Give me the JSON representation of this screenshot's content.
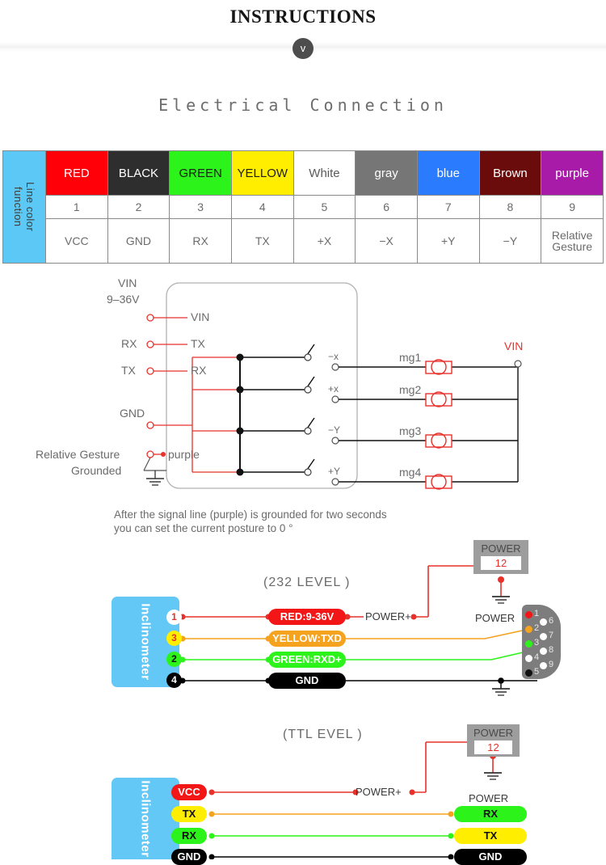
{
  "header": {
    "title": "INSTRUCTIONS",
    "chevron_icon": "chevron-down-icon",
    "chevron_glyph": "v",
    "section_title": "Electrical Connection"
  },
  "colors": {
    "accent_blue": "#63c8f5",
    "red": "#ff0008",
    "black": "#2e2e2e",
    "green": "#2cf319",
    "yellow": "#ffee00",
    "white": "#ffffff",
    "gray": "#767676",
    "blue": "#2b7bff",
    "brown": "#6b0c0c",
    "purple": "#a81aa8",
    "wire_red": "#e8312a",
    "wire_orange": "#f5a21e",
    "wire_green": "#2cf319",
    "power_gray": "#9d9d9d"
  },
  "table": {
    "row_header_label": "Line color\nfunction",
    "columns": [
      {
        "color_name": "RED",
        "bg": "#ff0008",
        "fg": "#ffffff",
        "number": "1",
        "function": "VCC"
      },
      {
        "color_name": "BLACK",
        "bg": "#2e2e2e",
        "fg": "#ffffff",
        "number": "2",
        "function": "GND"
      },
      {
        "color_name": "GREEN",
        "bg": "#2cf319",
        "fg": "#1d1d1d",
        "number": "3",
        "function": "RX"
      },
      {
        "color_name": "YELLOW",
        "bg": "#ffee00",
        "fg": "#1d1d1d",
        "number": "4",
        "function": "TX"
      },
      {
        "color_name": "White",
        "bg": "#ffffff",
        "fg": "#5a5a5a",
        "number": "5",
        "function": "+X"
      },
      {
        "color_name": "gray",
        "bg": "#767676",
        "fg": "#ffffff",
        "number": "6",
        "function": "−X"
      },
      {
        "color_name": "blue",
        "bg": "#2b7bff",
        "fg": "#ffffff",
        "number": "7",
        "function": "+Y"
      },
      {
        "color_name": "Brown",
        "bg": "#6b0c0c",
        "fg": "#ffffff",
        "number": "8",
        "function": "−Y"
      },
      {
        "color_name": "purple",
        "bg": "#a81aa8",
        "fg": "#ffffff",
        "number": "9",
        "function": "Relative\nGesture"
      }
    ]
  },
  "schematic": {
    "vin_label": "VIN",
    "vin_range": "9–36V",
    "left_terminals": [
      "RX",
      "TX"
    ],
    "inner_terminals": [
      "VIN",
      "TX",
      "RX"
    ],
    "gnd_label": "GND",
    "relative_gesture_label": "Relative Gesture",
    "grounded_label": "Grounded",
    "purple_label": "purple",
    "axis_terminals": [
      "−x",
      "+x",
      "−Y",
      "+Y"
    ],
    "coils": [
      "mg1",
      "mg2",
      "mg3",
      "mg4"
    ],
    "vin_right_label": "VIN",
    "caption_line1": "After the signal line (purple) is grounded for two seconds",
    "caption_line2": "you can set the current posture to 0 °"
  },
  "rs232": {
    "title": "(232 LEVEL )",
    "device_label": "Inclinometer",
    "rows": [
      {
        "pin": "1",
        "pin_bg": "#ffffff",
        "pin_fg": "#e8312a",
        "tag": "RED:9-36V",
        "tag_bg": "#f21616",
        "tag_fg": "#ffffff",
        "wire": "#e8312a"
      },
      {
        "pin": "3",
        "pin_bg": "#ffee00",
        "pin_fg": "#e8312a",
        "tag": "YELLOW:TXD",
        "tag_bg": "#f5a21e",
        "tag_fg": "#ffffff",
        "wire": "#f5a21e"
      },
      {
        "pin": "2",
        "pin_bg": "#2cf319",
        "pin_fg": "#111111",
        "tag": "GREEN:RXD+",
        "tag_bg": "#2cf319",
        "tag_fg": "#ffffff",
        "wire": "#2cf319"
      },
      {
        "pin": "4",
        "pin_bg": "#000000",
        "pin_fg": "#ffffff",
        "tag": "GND",
        "tag_bg": "#000000",
        "tag_fg": "#ffffff",
        "wire": "#000000"
      }
    ],
    "power_plus_label": "POWER+",
    "power_label": "POWER",
    "power_box": {
      "label": "POWER",
      "value": "12"
    },
    "db9_label": "POWER",
    "db9_pins_left": [
      {
        "n": "1",
        "color": "#f21616"
      },
      {
        "n": "2",
        "color": "#f5a21e"
      },
      {
        "n": "3",
        "color": "#2cf319"
      },
      {
        "n": "4",
        "color": "#ffffff"
      },
      {
        "n": "5",
        "color": "#111111"
      }
    ],
    "db9_pins_right": [
      {
        "n": "6",
        "color": "#ffffff"
      },
      {
        "n": "7",
        "color": "#ffffff"
      },
      {
        "n": "8",
        "color": "#ffffff"
      },
      {
        "n": "9",
        "color": "#ffffff"
      }
    ]
  },
  "ttl": {
    "title": "(TTL  EVEL )",
    "device_label": "Inclinometer",
    "power_plus_label": "POWER+",
    "power_label": "POWER",
    "power_box": {
      "label": "POWER",
      "value": "12"
    },
    "rows": [
      {
        "left_tag": "VCC",
        "left_bg": "#f21616",
        "left_fg": "#ffffff",
        "right_tag": "",
        "right_bg": "",
        "right_fg": "",
        "wire": "#e8312a"
      },
      {
        "left_tag": "TX",
        "left_bg": "#ffee00",
        "left_fg": "#111111",
        "right_tag": "RX",
        "right_bg": "#2cf319",
        "right_fg": "#111111",
        "wire": "#f5a21e"
      },
      {
        "left_tag": "RX",
        "left_bg": "#2cf319",
        "left_fg": "#111111",
        "right_tag": "TX",
        "right_bg": "#ffee00",
        "right_fg": "#111111",
        "wire": "#2cf319"
      },
      {
        "left_tag": "GND",
        "left_bg": "#000000",
        "left_fg": "#ffffff",
        "right_tag": "GND",
        "right_bg": "#000000",
        "right_fg": "#ffffff",
        "wire": "#000000"
      }
    ]
  }
}
